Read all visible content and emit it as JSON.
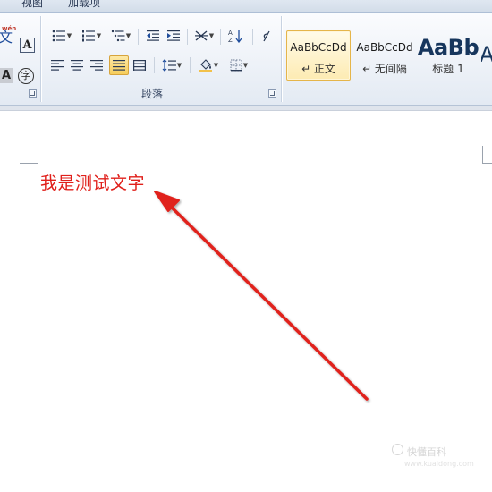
{
  "tabs": [
    {
      "label": "视图"
    },
    {
      "label": "加载项"
    }
  ],
  "font_group": {
    "phonetic_glyph": "文",
    "phonetic_sup": "wén",
    "char_border_glyph": "A",
    "char_shading_glyph": "A",
    "enclose_glyph": "字"
  },
  "paragraph_group": {
    "label": "段落"
  },
  "styles_gallery": {
    "items": [
      {
        "sample": "AaBbCcDd",
        "name": "↵ 正文",
        "active": true
      },
      {
        "sample": "AaBbCcDd",
        "name": "↵ 无间隔",
        "active": false
      },
      {
        "sample": "AaBb",
        "name": "标题 1",
        "active": false
      },
      {
        "sample": "A",
        "name": "",
        "active": false
      }
    ]
  },
  "document": {
    "text": "我是测试文字",
    "text_color": "#e0201b"
  },
  "annotation": {
    "arrow_color": "#e0201b"
  },
  "watermark": {
    "text": "快懂百科",
    "subtext": "www.kuaidong.com"
  },
  "colors": {
    "ribbon_bg": "#eef2f8",
    "active_highlight": "#f6cd5c",
    "accent_blue": "#1f4d9c"
  }
}
